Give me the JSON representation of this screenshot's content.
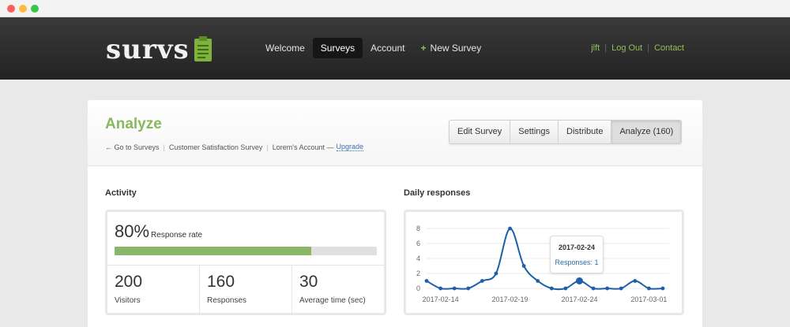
{
  "app": {
    "logo_text": "survs"
  },
  "nav": {
    "items": [
      {
        "label": "Welcome"
      },
      {
        "label": "Surveys"
      },
      {
        "label": "Account"
      },
      {
        "label": "New Survey"
      }
    ],
    "new_survey_plus": "+",
    "user": "jlft",
    "logout": "Log Out",
    "contact": "Contact",
    "separator": "|"
  },
  "page": {
    "title": "Analyze",
    "breadcrumb": {
      "back": "← Go to Surveys",
      "survey": "Customer Satisfaction Survey",
      "account": "Lorem's Account —",
      "upgrade": "Upgrade",
      "sep": "|"
    },
    "tabs": [
      {
        "label": "Edit Survey"
      },
      {
        "label": "Settings"
      },
      {
        "label": "Distribute"
      },
      {
        "label": "Analyze (160)"
      }
    ]
  },
  "activity": {
    "title": "Activity",
    "rate_value": "80%",
    "rate_label": "Response rate",
    "rate_fraction": 0.75,
    "stats": [
      {
        "value": "200",
        "label": "Visitors"
      },
      {
        "value": "160",
        "label": "Responses"
      },
      {
        "value": "30",
        "label": "Average time (sec)"
      }
    ]
  },
  "daily": {
    "title": "Daily responses",
    "tooltip": {
      "date": "2017-02-24",
      "responses": "Responses: 1"
    }
  },
  "colors": {
    "accent": "#8ab85e",
    "line": "#1f5fa8",
    "progress": "#89b767"
  },
  "chart_data": {
    "type": "line",
    "title": "Daily responses",
    "x": [
      "2017-02-13",
      "2017-02-14",
      "2017-02-15",
      "2017-02-16",
      "2017-02-17",
      "2017-02-18",
      "2017-02-19",
      "2017-02-20",
      "2017-02-21",
      "2017-02-22",
      "2017-02-23",
      "2017-02-24",
      "2017-02-25",
      "2017-02-26",
      "2017-02-27",
      "2017-02-28",
      "2017-03-01",
      "2017-03-02"
    ],
    "values": [
      1,
      0,
      0,
      0,
      1,
      2,
      8,
      3,
      1,
      0,
      0,
      1,
      0,
      0,
      0,
      1,
      0,
      0
    ],
    "x_tick_labels": [
      "2017-02-14",
      "2017-02-19",
      "2017-02-24",
      "2017-03-01"
    ],
    "y_ticks": [
      "0",
      "2",
      "4",
      "6",
      "8"
    ],
    "ylim": [
      0,
      8
    ],
    "highlight": "2017-02-24",
    "grid": true
  }
}
